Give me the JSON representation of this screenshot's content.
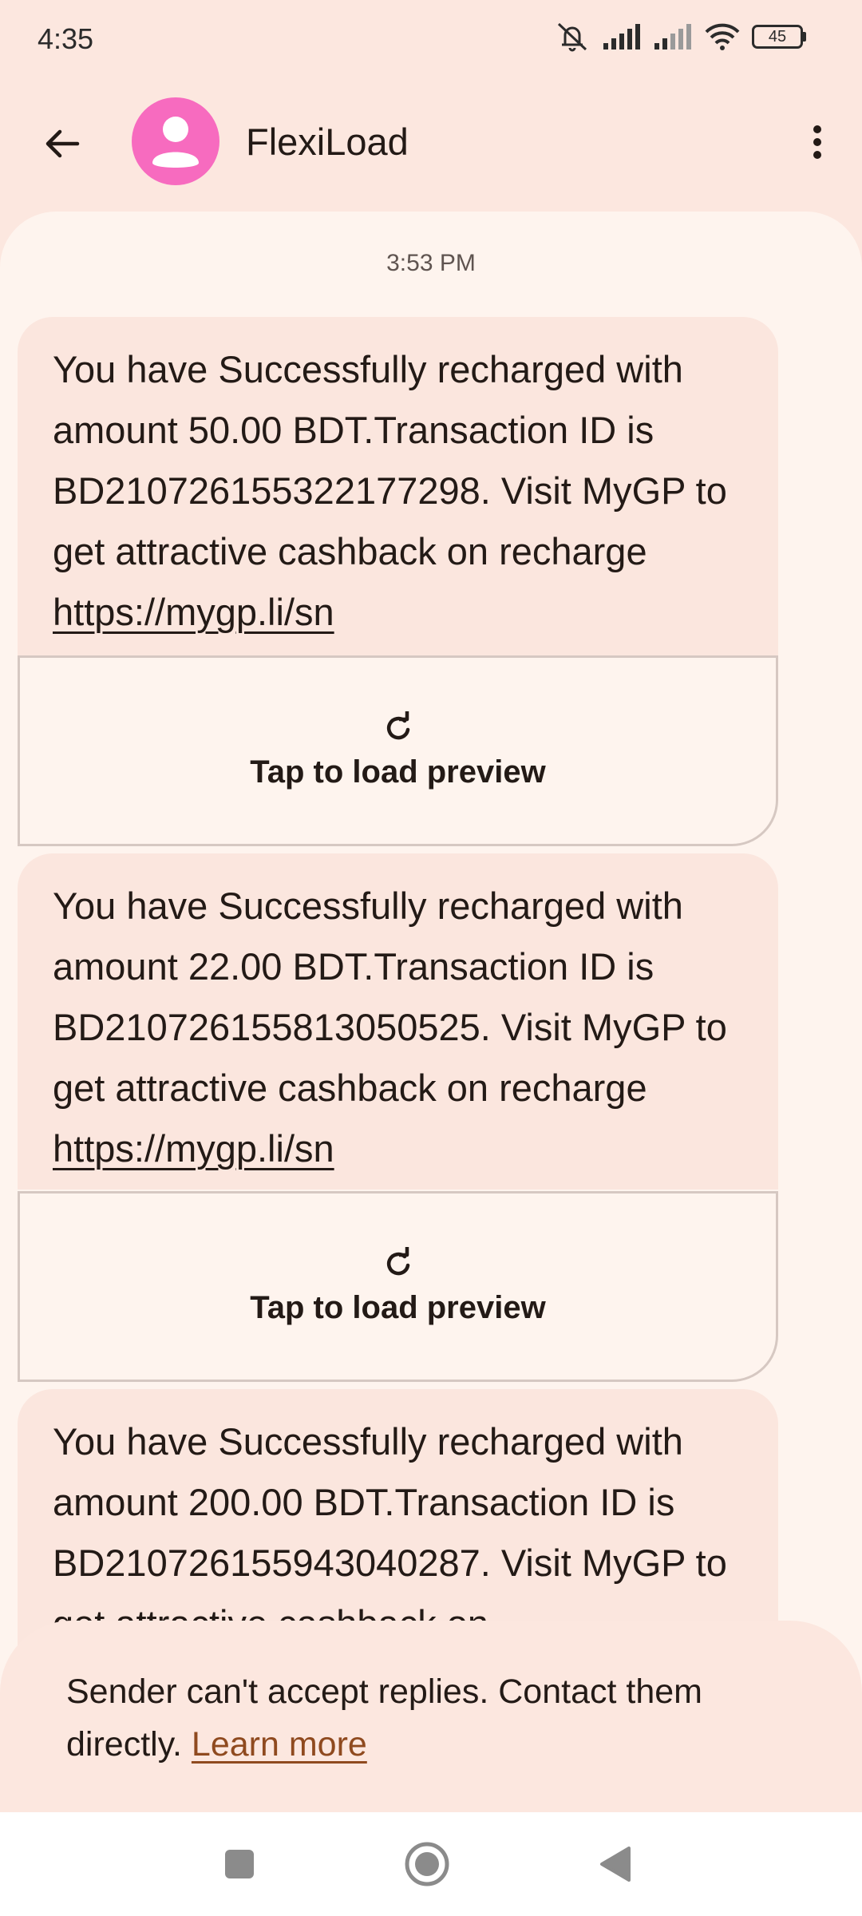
{
  "status_bar": {
    "time": "4:35",
    "battery": "45"
  },
  "app_bar": {
    "contact_name": "FlexiLoad"
  },
  "conversation": {
    "timestamp": "3:53 PM",
    "messages": [
      {
        "text": "You have Successfully recharged with amount 50.00 BDT.Transaction ID is BD210726155322177298. Visit MyGP to get attractive cashback on recharge ",
        "link": "https://mygp.li/sn",
        "preview_label": "Tap to load preview"
      },
      {
        "text": "You have Successfully recharged with amount 22.00 BDT.Transaction ID is BD210726155813050525. Visit MyGP to get attractive cashback on recharge ",
        "link": "https://mygp.li/sn",
        "preview_label": "Tap to load preview"
      },
      {
        "text": "You have Successfully recharged with amount 200.00 BDT.Transaction ID is BD210726155943040287. Visit MyGP to get attractive cashback on"
      }
    ]
  },
  "footer": {
    "text": "Sender can't accept replies. Contact them directly. ",
    "learn_more": "Learn more"
  },
  "icons": {
    "back": "arrow-left-icon",
    "menu": "more-vert-icon",
    "refresh": "refresh-icon",
    "nav_recents": "square-icon",
    "nav_home": "circle-icon",
    "nav_back": "triangle-icon"
  },
  "colors": {
    "background": "#fce7df",
    "surface": "#fef4ee",
    "bubble": "#fbe6de",
    "avatar": "#f76bbf",
    "link_accent": "#8f4a1f"
  }
}
